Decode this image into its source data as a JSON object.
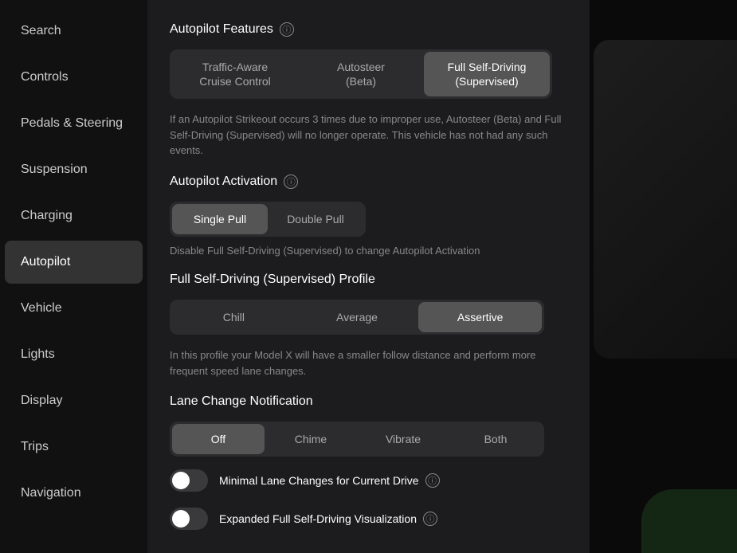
{
  "sidebar": {
    "items": [
      {
        "label": "Search",
        "id": "search",
        "active": false
      },
      {
        "label": "Controls",
        "id": "controls",
        "active": false
      },
      {
        "label": "Pedals & Steering",
        "id": "pedals-steering",
        "active": false
      },
      {
        "label": "Suspension",
        "id": "suspension",
        "active": false
      },
      {
        "label": "Charging",
        "id": "charging",
        "active": false
      },
      {
        "label": "Autopilot",
        "id": "autopilot",
        "active": true
      },
      {
        "label": "Vehicle",
        "id": "vehicle",
        "active": false
      },
      {
        "label": "Lights",
        "id": "lights",
        "active": false
      },
      {
        "label": "Display",
        "id": "display",
        "active": false
      },
      {
        "label": "Trips",
        "id": "trips",
        "active": false
      },
      {
        "label": "Navigation",
        "id": "navigation",
        "active": false
      }
    ]
  },
  "autopilot_features": {
    "section_title": "Autopilot Features",
    "tabs": [
      {
        "label": "Traffic-Aware\nCruise Control",
        "active": false
      },
      {
        "label": "Autosteer\n(Beta)",
        "active": false
      },
      {
        "label": "Full Self-Driving\n(Supervised)",
        "active": true
      }
    ],
    "info_text": "If an Autopilot Strikeout occurs 3 times due to improper use, Autosteer (Beta) and Full Self-Driving (Supervised) will no longer operate. This vehicle has not had any such events."
  },
  "autopilot_activation": {
    "section_title": "Autopilot Activation",
    "tabs": [
      {
        "label": "Single Pull",
        "active": true
      },
      {
        "label": "Double Pull",
        "active": false
      }
    ],
    "disable_text": "Disable Full Self-Driving (Supervised) to change Autopilot Activation"
  },
  "fsd_profile": {
    "section_title": "Full Self-Driving (Supervised) Profile",
    "tabs": [
      {
        "label": "Chill",
        "active": false
      },
      {
        "label": "Average",
        "active": false
      },
      {
        "label": "Assertive",
        "active": true
      }
    ],
    "info_text": "In this profile your Model X will have a smaller follow distance and perform more frequent speed lane changes."
  },
  "lane_change_notification": {
    "section_title": "Lane Change Notification",
    "tabs": [
      {
        "label": "Off",
        "active": true
      },
      {
        "label": "Chime",
        "active": false
      },
      {
        "label": "Vibrate",
        "active": false
      },
      {
        "label": "Both",
        "active": false
      }
    ]
  },
  "toggles": [
    {
      "id": "minimal-lane-changes",
      "label": "Minimal Lane Changes for Current Drive",
      "on": false,
      "has_info": true
    },
    {
      "id": "expanded-fsd-viz",
      "label": "Expanded Full Self-Driving Visualization",
      "on": false,
      "has_info": true
    }
  ]
}
